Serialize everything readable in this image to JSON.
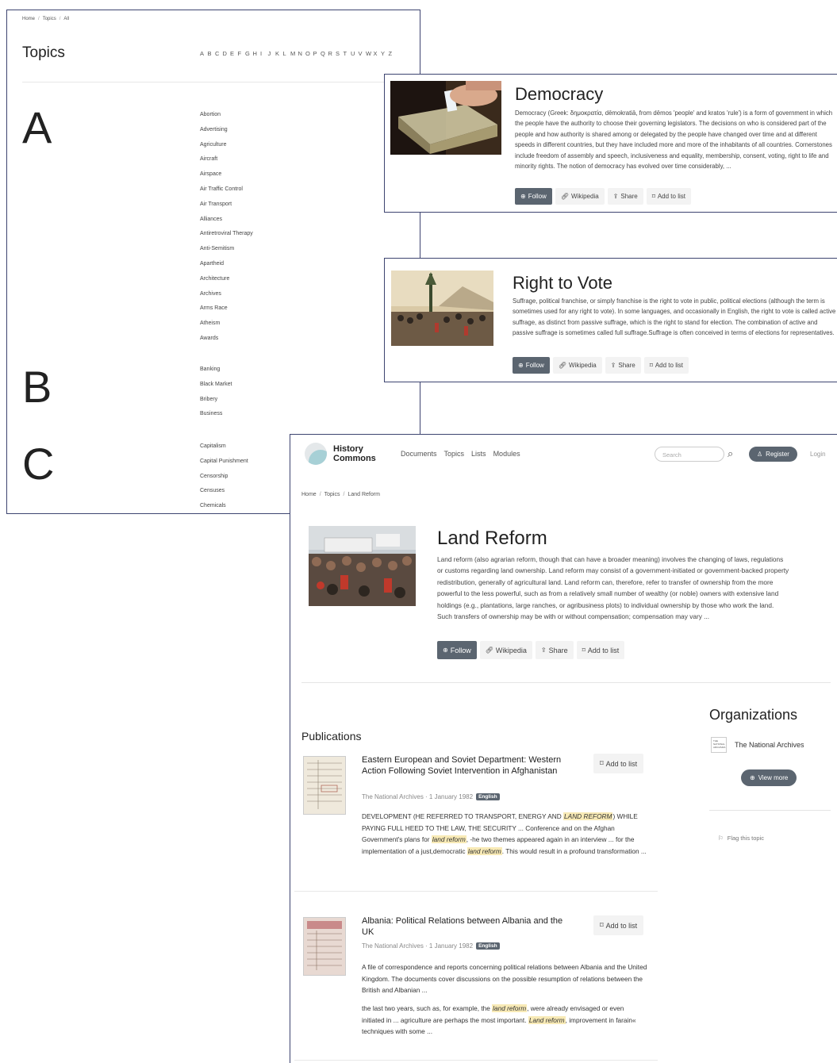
{
  "topics_panel": {
    "breadcrumb": [
      "Home",
      "Topics",
      "All"
    ],
    "title": "Topics",
    "alphabet": [
      "A",
      "B",
      "C",
      "D",
      "E",
      "F",
      "G",
      "H",
      "I",
      "J",
      "K",
      "L",
      "M",
      "N",
      "O",
      "P",
      "Q",
      "R",
      "S",
      "T",
      "U",
      "V",
      "W",
      "X",
      "Y",
      "Z"
    ],
    "groups": [
      {
        "letter": "A",
        "items": [
          "Abortion",
          "Advertising",
          "Agriculture",
          "Aircraft",
          "Airspace",
          "Air Traffic Control",
          "Air Transport",
          "Alliances",
          "Antiretroviral Therapy",
          "Anti-Semitism",
          "Apartheid",
          "Architecture",
          "Archives",
          "Arms Race",
          "Atheism",
          "Awards"
        ]
      },
      {
        "letter": "B",
        "items": [
          "Banking",
          "Black Market",
          "Bribery",
          "Business"
        ]
      },
      {
        "letter": "C",
        "items": [
          "Capitalism",
          "Capital Punishment",
          "Censorship",
          "Censuses",
          "Chemicals"
        ]
      }
    ]
  },
  "democracy_card": {
    "title": "Democracy",
    "description": "Democracy (Greek: δημοκρατία, dēmokratiā, from dēmos 'people' and kratos 'rule') is a form of government in which the people have the authority to choose their governing legislators. The decisions on who is considered part of the people and how authority is shared among or delegated by the people have changed over time and at different speeds in different countries, but they have included more and more of the inhabitants of all countries. Cornerstones include freedom of assembly and speech, inclusiveness and equality, membership, consent, voting, right to life and minority rights. The notion of democracy has evolved over time considerably, ...",
    "follow": "Follow",
    "wikipedia": "Wikipedia",
    "share": "Share",
    "add_to_list": "Add to list"
  },
  "vote_card": {
    "title": "Right to Vote",
    "description": "Suffrage, political franchise, or simply franchise is the right to vote in public, political elections (although the term is sometimes used for any right to vote). In some languages, and occasionally in English, the right to vote is called active suffrage, as distinct from passive suffrage, which is the right to stand for election. The combination of active and passive suffrage is sometimes called full suffrage.Suffrage is often conceived in terms of elections for representatives.",
    "follow": "Follow",
    "wikipedia": "Wikipedia",
    "share": "Share",
    "add_to_list": "Add to list"
  },
  "main_page": {
    "brand_line1": "History",
    "brand_line2": "Commons",
    "nav": [
      "Documents",
      "Topics",
      "Lists",
      "Modules"
    ],
    "search_placeholder": "Search",
    "register": "Register",
    "login": "Login",
    "breadcrumb": [
      "Home",
      "Topics",
      "Land Reform"
    ],
    "title": "Land Reform",
    "description": "Land reform (also agrarian reform, though that can have a broader meaning) involves the changing of laws, regulations or customs regarding land ownership. Land reform may consist of a government-initiated or government-backed property redistribution, generally of agricultural land. Land reform can, therefore, refer to transfer of ownership from the more powerful to the less powerful, such as from a relatively small number of wealthy (or noble) owners with extensive land holdings (e.g., plantations, large ranches, or agribusiness plots) to individual ownership by those who work the land. Such transfers of ownership may be with or without compensation; compensation may vary ...",
    "follow": "Follow",
    "wikipedia": "Wikipedia",
    "share": "Share",
    "add_to_list": "Add to list",
    "publications_heading": "Publications",
    "publications": [
      {
        "title": "Eastern European and Soviet Department: Western Action Following Soviet Intervention in Afghanistan",
        "source": "The National Archives · 1 January 1982",
        "language": "English",
        "add_to_list": "Add to list",
        "excerpt_parts": [
          "DEVELOPMENT (HE REFERRED TO TRANSPORT, ENERGY AND ",
          "LAND REFORM",
          ") WHILE PAYING FULL HEED TO THE LAW, THE SECURITY  ...  Conference and on the Afghan Government's plans for ",
          "land reform",
          ", -he two themes appeared again in an interview  ...  for the implementation of a just,democratic ",
          "land reform",
          ". This would result in a profound transformation  ..."
        ]
      },
      {
        "title": "Albania: Political Relations between Albania and the UK",
        "source": "The National Archives · 1 January 1982",
        "language": "English",
        "add_to_list": "Add to list",
        "excerpt": "A file of correspondence and reports concerning political relations between Albania and the United Kingdom. The documents cover discussions on the possible resumption of relations between the British and Albanian ...",
        "excerpt2_parts": [
          "the last two years, such as, for example, the ",
          "land reform",
          ", were already envisaged or even initiated in  ...  agriculture are perhaps the most important. ",
          "Land reform",
          ", improvement in farain« techniques with some  ..."
        ]
      }
    ],
    "organizations_heading": "Organizations",
    "organization": "The National Archives",
    "organization_logo_text": "THE NATIONAL ARCHIVES",
    "view_more": "View more",
    "flag_topic": "Flag this topic"
  },
  "colors": {
    "primary_button": "#5b6570",
    "panel_border": "#3d4470",
    "highlight": "#f8eab6"
  }
}
